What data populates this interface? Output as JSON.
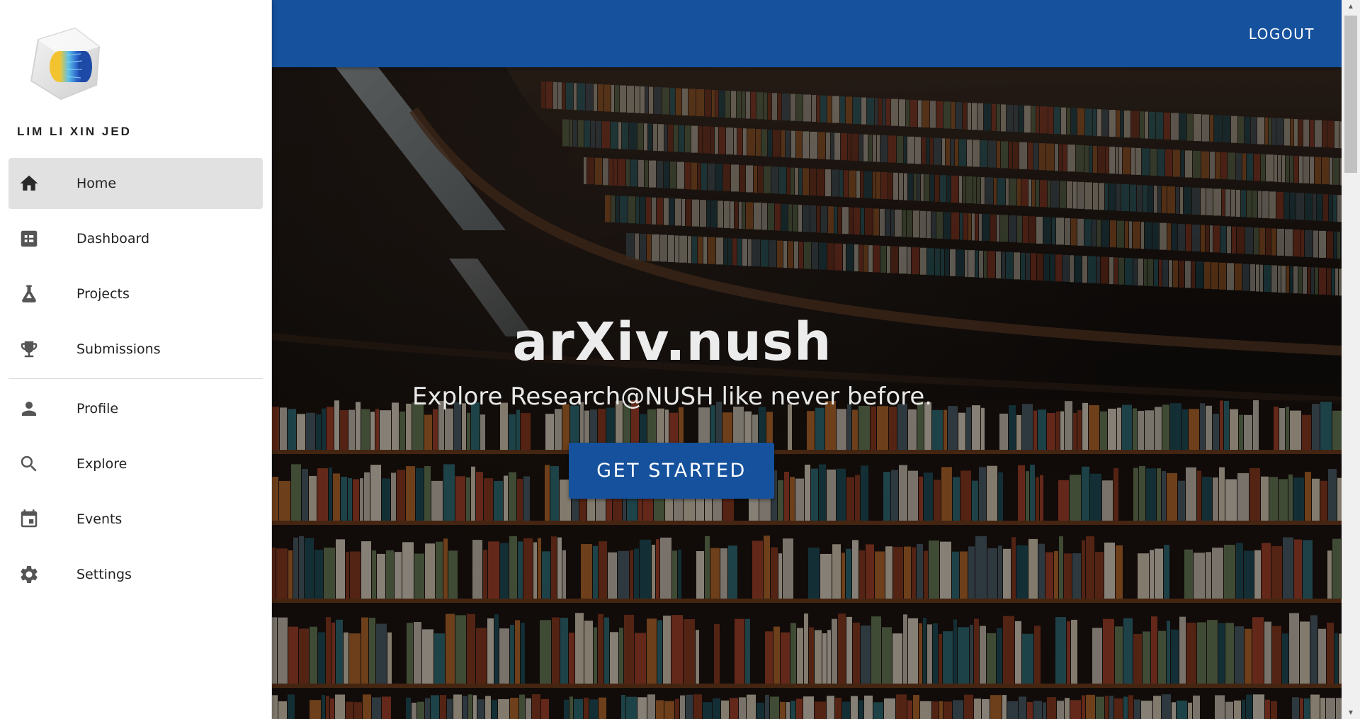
{
  "sidebar": {
    "user_name": "LIM LI XIN JED",
    "items": [
      {
        "label": "Home",
        "icon": "home-icon",
        "active": true
      },
      {
        "label": "Dashboard",
        "icon": "dashboard-icon",
        "active": false
      },
      {
        "label": "Projects",
        "icon": "flask-icon",
        "active": false
      },
      {
        "label": "Submissions",
        "icon": "trophy-icon",
        "active": false
      },
      {
        "label": "Profile",
        "icon": "person-icon",
        "active": false
      },
      {
        "label": "Explore",
        "icon": "search-icon",
        "active": false
      },
      {
        "label": "Events",
        "icon": "calendar-icon",
        "active": false
      },
      {
        "label": "Settings",
        "icon": "gear-icon",
        "active": false
      }
    ]
  },
  "appbar": {
    "logout_label": "LOGOUT",
    "color": "#15519d"
  },
  "hero": {
    "title": "arXiv.nush",
    "subtitle": "Explore Research@NUSH like never before.",
    "cta_label": "GET STARTED",
    "background": "library-bookshelves-photo"
  },
  "colors": {
    "primary": "#15519d",
    "active_nav_bg": "#e1e1e1"
  }
}
